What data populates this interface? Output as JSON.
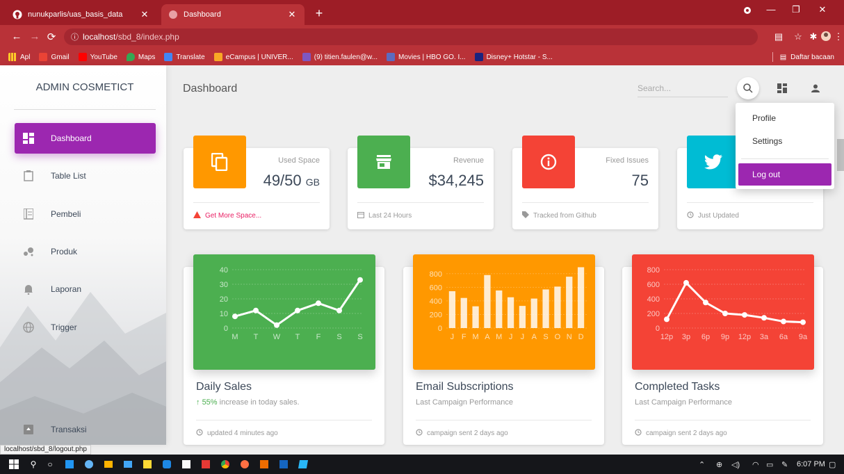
{
  "browser": {
    "tabs": [
      {
        "title": "nunukparlis/uas_basis_data",
        "icon": "github-icon"
      },
      {
        "title": "Dashboard",
        "icon": "globe-icon"
      }
    ],
    "url_host": "localhost",
    "url_path": "/sbd_8/index.php",
    "bookmarks": [
      {
        "label": "Apl",
        "color": "#e53935"
      },
      {
        "label": "Gmail",
        "color": "#ea4335"
      },
      {
        "label": "YouTube",
        "color": "#ff0000"
      },
      {
        "label": "Maps",
        "color": "#34a853"
      },
      {
        "label": "Translate",
        "color": "#4285f4"
      },
      {
        "label": "eCampus | UNIVER...",
        "color": "#f9a825"
      },
      {
        "label": "(9) titien.faulen@w...",
        "color": "#7e57c2"
      },
      {
        "label": "Movies | HBO GO. I...",
        "color": "#5c6bc0"
      },
      {
        "label": "Disney+ Hotstar - S...",
        "color": "#1a237e"
      }
    ],
    "reading_list": "Daftar bacaan",
    "status_url": "localhost/sbd_8/logout.php"
  },
  "sidebar": {
    "brand": "ADMIN COSMETICT",
    "items": [
      {
        "label": "Dashboard",
        "icon": "dashboard-icon",
        "active": true
      },
      {
        "label": "Table List",
        "icon": "clipboard-icon"
      },
      {
        "label": "Pembeli",
        "icon": "list-icon"
      },
      {
        "label": "Produk",
        "icon": "bubble-icon"
      },
      {
        "label": "Laporan",
        "icon": "bell-icon"
      },
      {
        "label": "Trigger",
        "icon": "globe-icon"
      },
      {
        "label": "Transaksi",
        "icon": "unarchive-icon"
      }
    ]
  },
  "header": {
    "title": "Dashboard",
    "search_placeholder": "Search...",
    "dropdown": {
      "profile": "Profile",
      "settings": "Settings",
      "logout": "Log out"
    }
  },
  "stats": [
    {
      "category": "Used Space",
      "value": "49/50",
      "unit": "GB",
      "footer": "Get More Space...",
      "color": "#ff9800",
      "icon": "content-copy-icon"
    },
    {
      "category": "Revenue",
      "value": "$34,245",
      "footer": "Last 24 Hours",
      "color": "#4caf50",
      "icon": "store-icon"
    },
    {
      "category": "Fixed Issues",
      "value": "75",
      "footer": "Tracked from Github",
      "color": "#f44336",
      "icon": "info-icon"
    },
    {
      "category": "",
      "value": "",
      "footer": "Just Updated",
      "color": "#00bcd4",
      "icon": "twitter-icon"
    }
  ],
  "charts": [
    {
      "title": "Daily Sales",
      "subtitle_pct": "55%",
      "subtitle_rest": " increase in today sales.",
      "footer": "updated 4 minutes ago",
      "color": "#4caf50"
    },
    {
      "title": "Email Subscriptions",
      "subtitle": "Last Campaign Performance",
      "footer": "campaign sent 2 days ago",
      "color": "#ff9800"
    },
    {
      "title": "Completed Tasks",
      "subtitle": "Last Campaign Performance",
      "footer": "campaign sent 2 days ago",
      "color": "#f44336"
    }
  ],
  "chart_data": [
    {
      "type": "line",
      "categories": [
        "M",
        "T",
        "W",
        "T",
        "F",
        "S",
        "S"
      ],
      "values": [
        8,
        12,
        2,
        12,
        17,
        12,
        33
      ],
      "yticks": [
        0,
        10,
        20,
        30,
        40
      ],
      "ylim": [
        0,
        40
      ],
      "title": "Daily Sales"
    },
    {
      "type": "bar",
      "categories": [
        "J",
        "F",
        "M",
        "A",
        "M",
        "J",
        "J",
        "A",
        "S",
        "O",
        "N",
        "D"
      ],
      "values": [
        542,
        443,
        320,
        780,
        553,
        453,
        326,
        434,
        568,
        610,
        756,
        895
      ],
      "yticks": [
        0,
        200,
        400,
        600,
        800
      ],
      "ylim": [
        0,
        900
      ],
      "title": "Email Subscriptions"
    },
    {
      "type": "line",
      "categories": [
        "12p",
        "3p",
        "6p",
        "9p",
        "12p",
        "3a",
        "6a",
        "9a"
      ],
      "values": [
        120,
        620,
        350,
        200,
        180,
        140,
        90,
        80
      ],
      "yticks": [
        0,
        200,
        400,
        600,
        800
      ],
      "ylim": [
        0,
        800
      ],
      "title": "Completed Tasks"
    }
  ],
  "taskbar": {
    "time": "6:07 PM"
  }
}
